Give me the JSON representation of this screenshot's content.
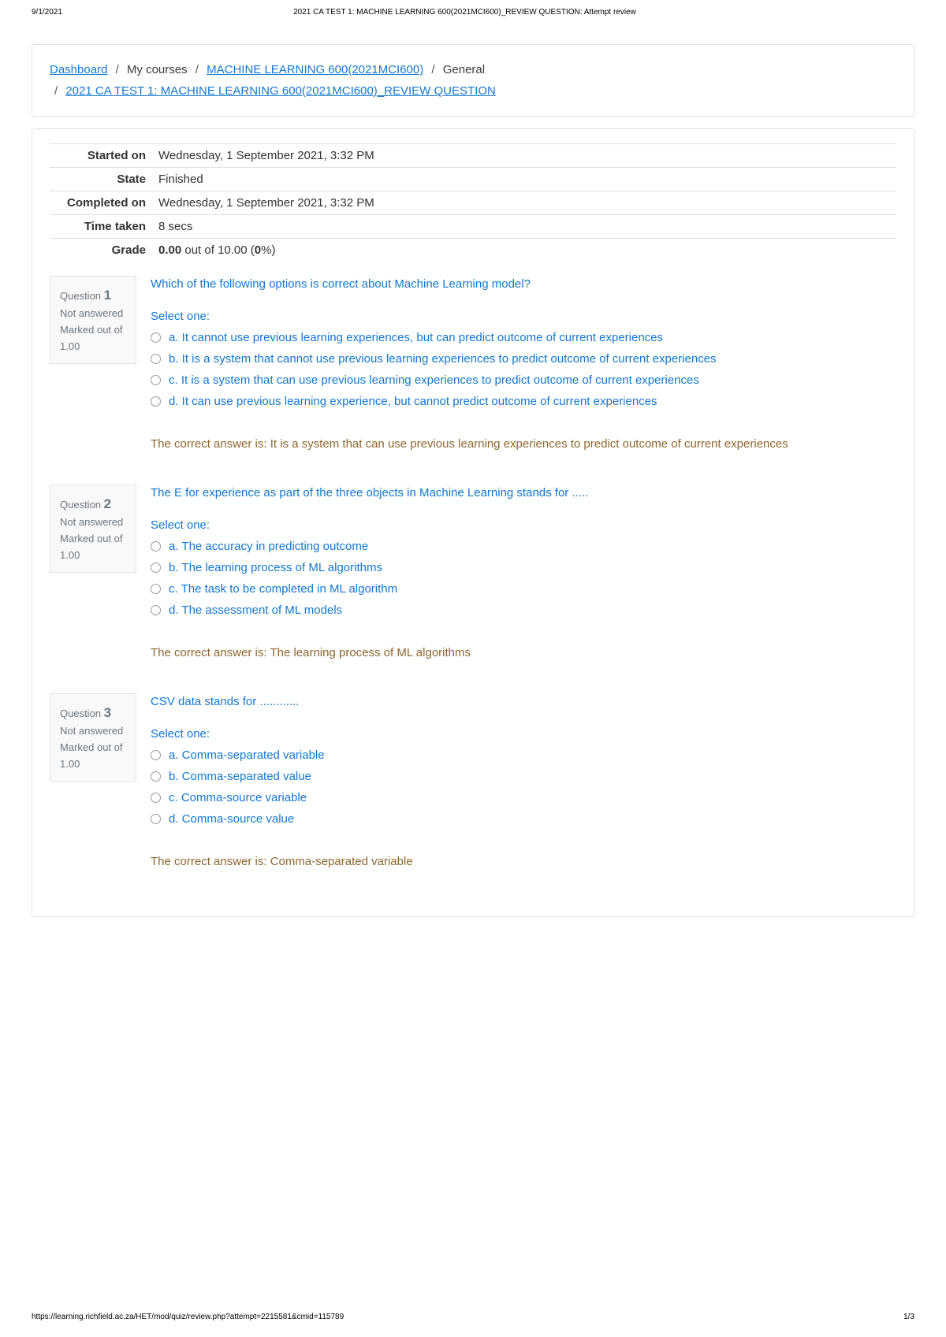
{
  "print": {
    "date": "9/1/2021",
    "title": "2021 CA TEST 1: MACHINE LEARNING 600(2021MCI600)_REVIEW QUESTION: Attempt review",
    "url": "https://learning.richfield.ac.za/HET/mod/quiz/review.php?attempt=2215581&cmid=115789",
    "page": "1/3"
  },
  "breadcrumb": {
    "dashboard": "Dashboard",
    "mycourses": "My courses",
    "course": "MACHINE LEARNING 600(2021MCI600)",
    "section": "General",
    "activity": "2021 CA TEST 1: MACHINE LEARNING 600(2021MCI600)_REVIEW QUESTION"
  },
  "summary": {
    "started_label": "Started on",
    "started_value": "Wednesday, 1 September 2021, 3:32 PM",
    "state_label": "State",
    "state_value": "Finished",
    "completed_label": "Completed on",
    "completed_value": "Wednesday, 1 September 2021, 3:32 PM",
    "time_label": "Time taken",
    "time_value": "8 secs",
    "grade_label": "Grade",
    "grade_score": "0.00",
    "grade_mid": " out of 10.00 (",
    "grade_pct": "0",
    "grade_end": "%)"
  },
  "qlabel": "Question",
  "select_one": "Select one:",
  "questions": [
    {
      "num": "1",
      "status": "Not answered",
      "mark_label": "Marked out of 1.00",
      "text": "Which of the following options is correct about Machine Learning model?",
      "options": [
        "a. It cannot use previous learning experiences, but can predict outcome of current experiences",
        "b. It is a system that cannot use previous learning experiences to predict outcome of current experiences",
        "c. It is a system that can use previous learning experiences to predict outcome of current experiences",
        "d. It can use previous learning experience, but cannot predict outcome of current experiences"
      ],
      "feedback": "The correct answer is: It is a system that can use previous learning experiences to predict outcome of current experiences"
    },
    {
      "num": "2",
      "status": "Not answered",
      "mark_label": "Marked out of 1.00",
      "text": "The E for experience as part of the three objects in Machine Learning stands for .....",
      "options": [
        "a. The accuracy in predicting outcome",
        "b. The learning process of ML algorithms",
        "c. The task to be completed in ML algorithm",
        "d. The assessment of ML models"
      ],
      "feedback": "The correct answer is: The learning process of ML algorithms"
    },
    {
      "num": "3",
      "status": "Not answered",
      "mark_label": "Marked out of 1.00",
      "text": "CSV data stands for ............",
      "options": [
        "a. Comma-separated variable",
        "b. Comma-separated value",
        "c. Comma-source variable",
        "d. Comma-source value"
      ],
      "feedback": "The correct answer is: Comma-separated variable"
    }
  ]
}
